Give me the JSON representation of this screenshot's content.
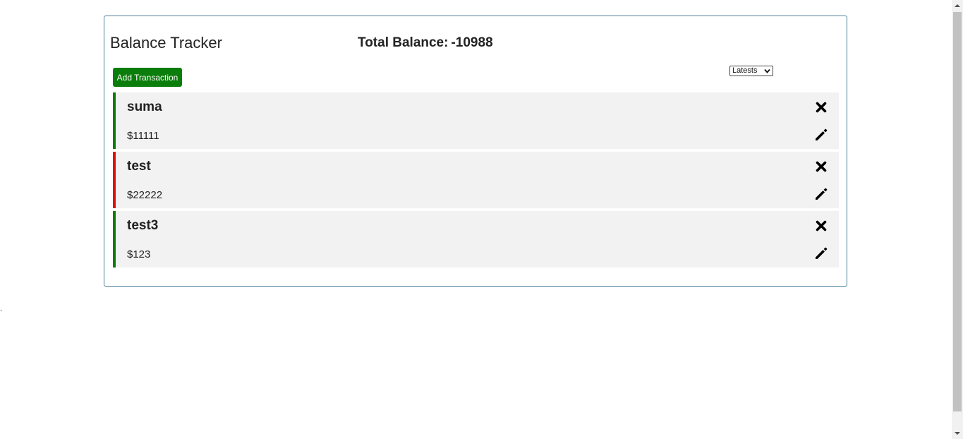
{
  "app": {
    "title": "Balance Tracker",
    "total_label": "Total Balance:",
    "total_value": "-10988"
  },
  "toolbar": {
    "add_label": "Add Transaction",
    "sort_selected": "Latests"
  },
  "transactions": [
    {
      "name": "suma",
      "amount": "$11111",
      "type": "income"
    },
    {
      "name": "test",
      "amount": "$22222",
      "type": "expense"
    },
    {
      "name": "test3",
      "amount": "$123",
      "type": "income"
    }
  ],
  "icons": {
    "delete": "close-icon",
    "edit": "pencil-icon"
  },
  "colors": {
    "income": "#0a7d0a",
    "expense": "#e01010",
    "button": "#0a7d0a",
    "card_border": "#4a7f99",
    "item_background": "#f2f2f2"
  },
  "stray_char": ","
}
